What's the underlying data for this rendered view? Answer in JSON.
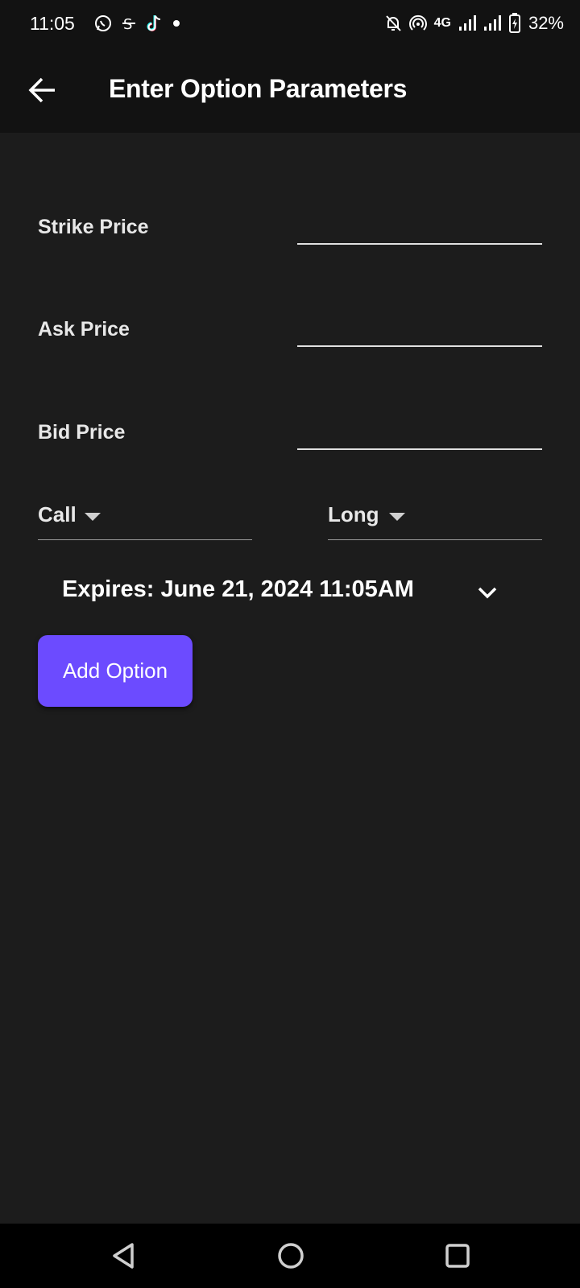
{
  "status_bar": {
    "time": "11:05",
    "network": "4G",
    "battery": "32%",
    "icons_left": [
      "whatsapp-icon",
      "s-app-icon",
      "tiktok-icon",
      "dot-icon"
    ],
    "icons_right": [
      "bell-off-icon",
      "hotspot-icon",
      "signal-icon",
      "signal-icon",
      "battery-charging-icon"
    ]
  },
  "app_bar": {
    "title": "Enter Option Parameters",
    "back_icon": "arrow-back-icon"
  },
  "form": {
    "strike_label": "Strike Price",
    "strike_value": "",
    "ask_label": "Ask Price",
    "ask_value": "",
    "bid_label": "Bid Price",
    "bid_value": "",
    "option_type_selected": "Call",
    "position_selected": "Long",
    "expires_text": "Expires: June 21, 2024 11:05AM",
    "add_button_label": "Add Option"
  },
  "colors": {
    "background": "#1c1c1c",
    "app_bar": "#121212",
    "accent": "#6c4bff"
  }
}
